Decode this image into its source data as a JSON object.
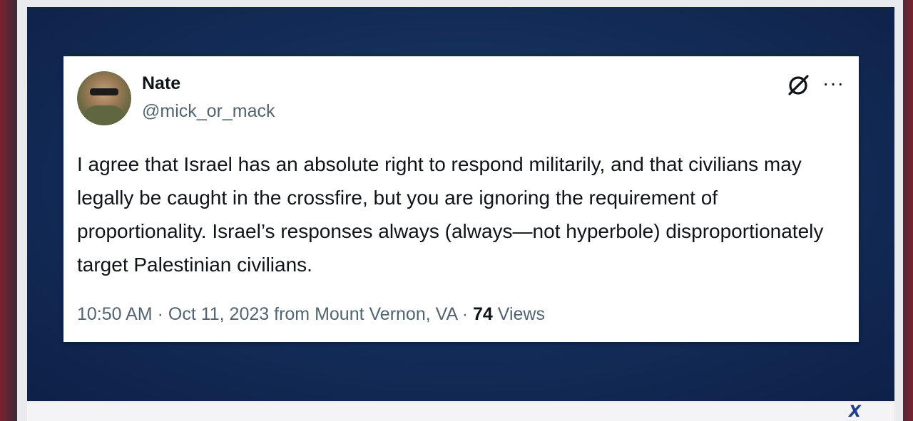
{
  "tweet": {
    "author_name": "Nate",
    "author_handle": "@mick_or_mack",
    "text": "I agree that Israel has an absolute right to respond militarily, and that civilians may legally be caught in the crossfire, but you are ignoring the requirement of proportionality. Israel’s responses always (always—not hyperbole) disproportionately target Palestinian civilians.",
    "time": "10:50 AM",
    "separator": "·",
    "date": "Oct 11, 2023",
    "location": "from Mount Vernon, VA",
    "views_count": "74",
    "views_label": "Views",
    "more_glyph": "···"
  },
  "overlay": {
    "logo": "X"
  },
  "icons": {
    "avatar": "avatar-photo",
    "grok": "grok-icon",
    "more": "more-icon"
  },
  "colors": {
    "background_panel": "#132c57",
    "text_primary": "#0f1419",
    "text_secondary": "#536471",
    "logo": "#1c3f8c"
  }
}
